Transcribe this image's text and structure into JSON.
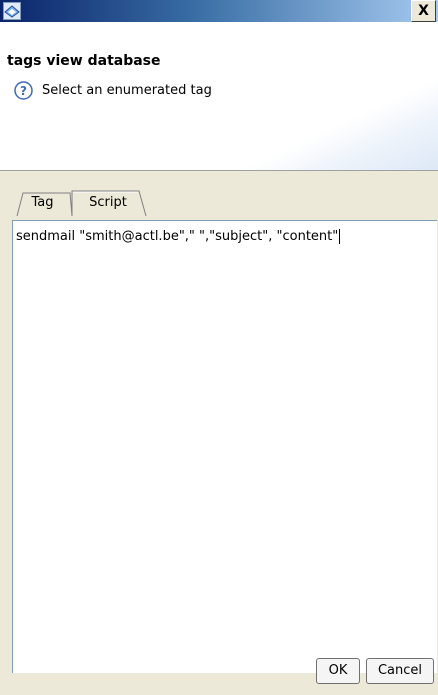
{
  "window": {
    "close_label": "X"
  },
  "header": {
    "title": "tags view database",
    "message": "Select an enumerated tag"
  },
  "tabs": [
    {
      "label": "Tag",
      "selected": false
    },
    {
      "label": "Script",
      "selected": true
    }
  ],
  "script": {
    "content": "sendmail \"smith@actl.be\",\" \",\"subject\", \"content\""
  },
  "buttons": {
    "ok_label": "OK",
    "cancel_label": "Cancel"
  },
  "colors": {
    "titlebar": "#0a246a",
    "dialog_bg": "#ece9d8",
    "help_icon": "#3f6bb8"
  }
}
